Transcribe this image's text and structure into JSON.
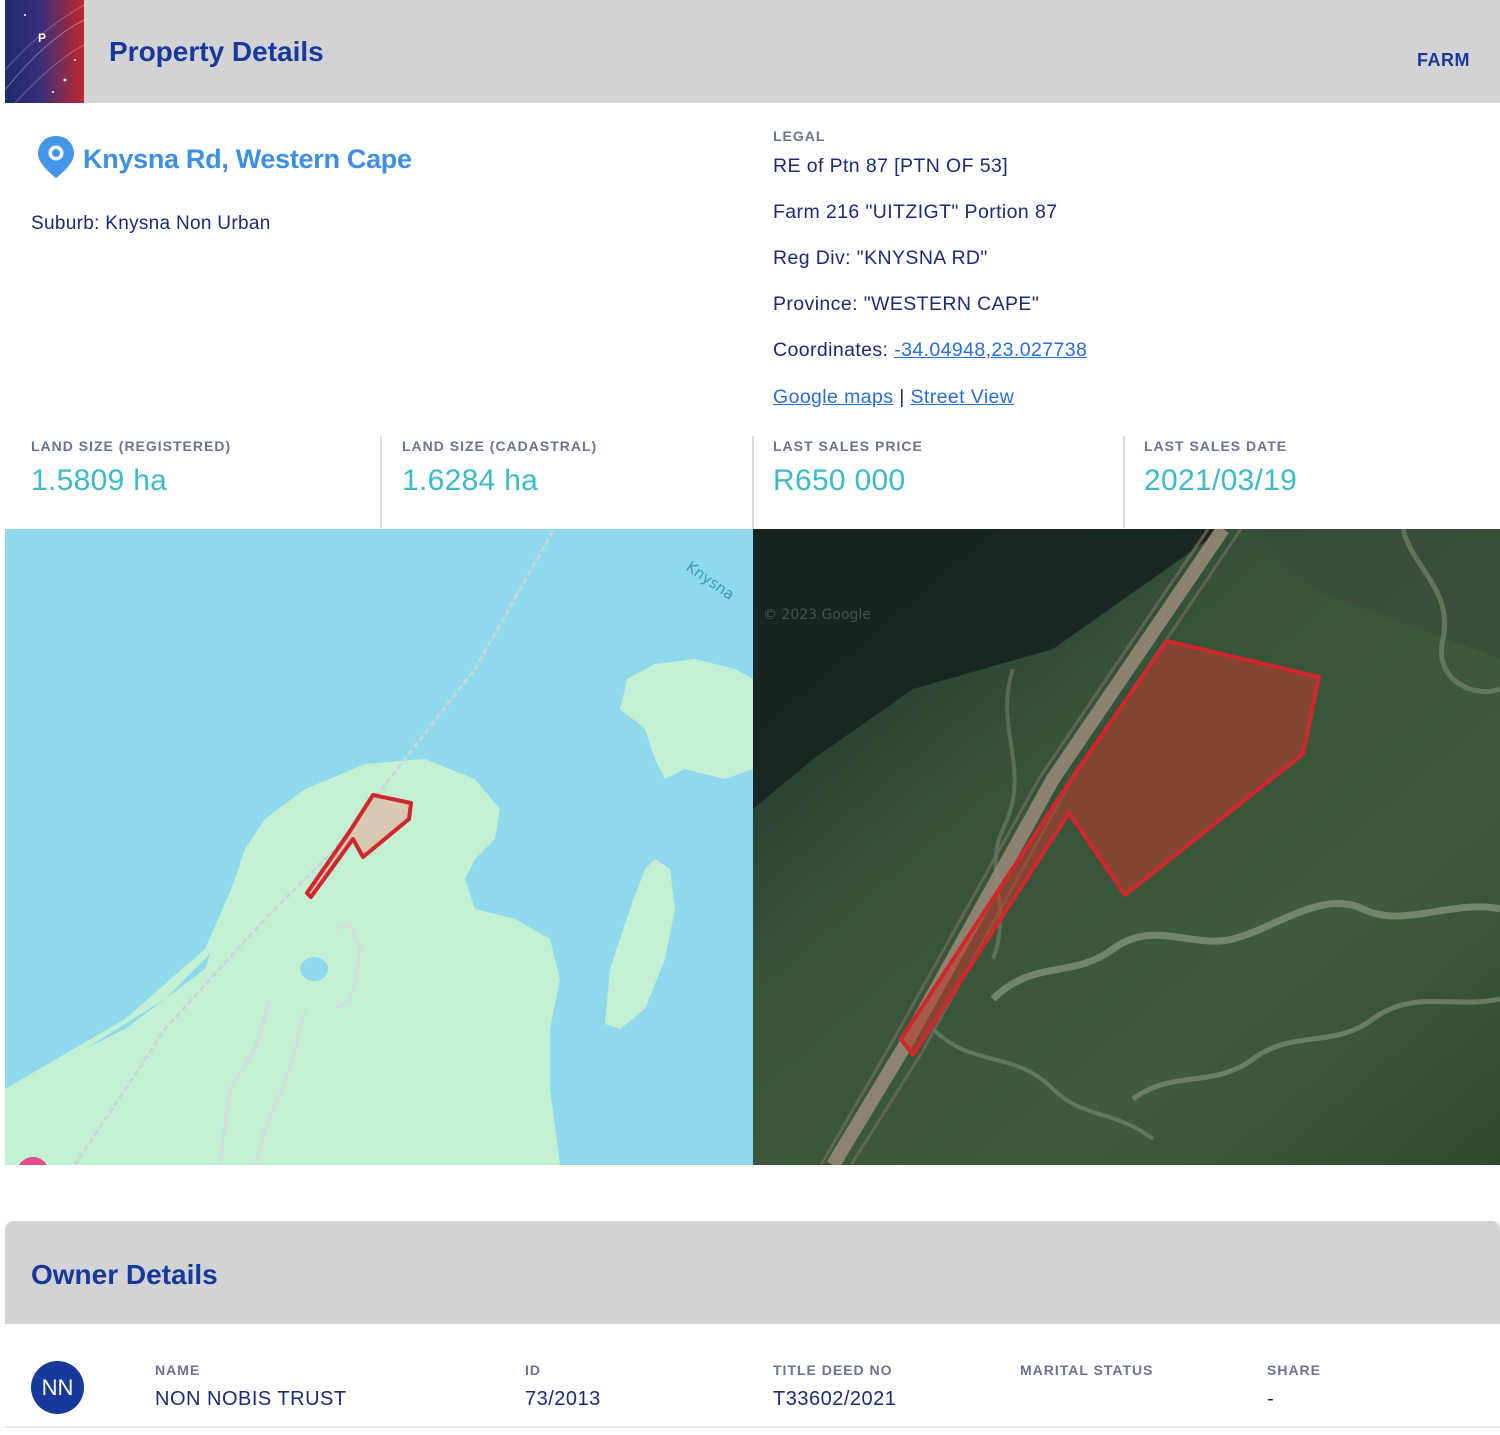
{
  "header": {
    "logo_letter": "P",
    "title": "Property Details",
    "badge": "FARM"
  },
  "address": {
    "title": "Knysna Rd, Western Cape",
    "suburb": "Suburb: Knysna Non Urban"
  },
  "legal": {
    "label": "LEGAL",
    "lines": [
      "RE of Ptn 87 [PTN OF 53]",
      "Farm 216 \"UITZIGT\" Portion 87",
      "Reg Div: \"KNYSNA RD\"",
      "Province: \"WESTERN CAPE\""
    ],
    "coords_label": "Coordinates: ",
    "coords_value": "-34.04948,23.027738",
    "google_maps": "Google maps",
    "separator": "|",
    "street_view": "Street View"
  },
  "stats": [
    {
      "label": "LAND SIZE (REGISTERED)",
      "value": "1.5809 ha"
    },
    {
      "label": "LAND SIZE (CADASTRAL)",
      "value": "1.6284 ha"
    },
    {
      "label": "LAST SALES PRICE",
      "value": "R650 000"
    },
    {
      "label": "LAST SALES DATE",
      "value": "2021/03/19"
    }
  ],
  "map": {
    "water_label": "Knysna",
    "satellite_watermark": "© 2023 Google"
  },
  "owner": {
    "title": "Owner Details",
    "avatar": "NN",
    "columns": [
      {
        "label": "NAME",
        "value": "NON NOBIS TRUST"
      },
      {
        "label": "ID",
        "value": "73/2013"
      },
      {
        "label": "TITLE DEED NO",
        "value": "T33602/2021"
      },
      {
        "label": "MARITAL STATUS",
        "value": ""
      },
      {
        "label": "SHARE",
        "value": "-"
      }
    ]
  }
}
